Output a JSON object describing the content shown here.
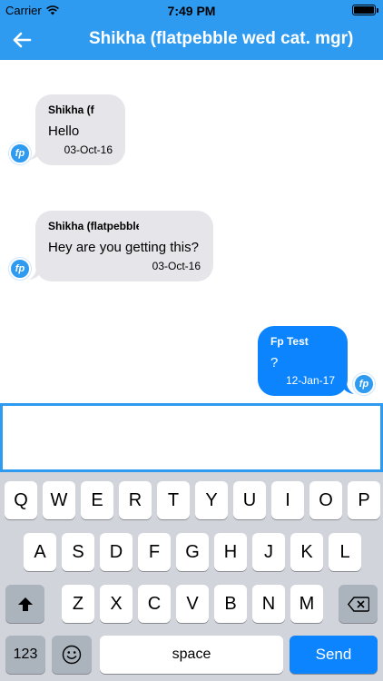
{
  "status": {
    "carrier": "Carrier",
    "time": "7:49 PM",
    "battery_fraction": 1.0
  },
  "nav": {
    "title": "Shikha (flatpebble wed cat. mgr)"
  },
  "messages": [
    {
      "sender": "Shikha (f",
      "text": "Hello",
      "date": "03-Oct-16",
      "direction": "incoming"
    },
    {
      "sender": "Shikha (flatpebble",
      "text": "Hey are you getting this?",
      "date": "03-Oct-16",
      "direction": "incoming"
    },
    {
      "sender": "Fp Test",
      "text": "?",
      "date": "12-Jan-17",
      "direction": "outgoing"
    }
  ],
  "avatar": {
    "label": "fp"
  },
  "composer": {
    "value": "",
    "placeholder": ""
  },
  "keyboard": {
    "row1": [
      "Q",
      "W",
      "E",
      "R",
      "T",
      "Y",
      "U",
      "I",
      "O",
      "P"
    ],
    "row2": [
      "A",
      "S",
      "D",
      "F",
      "G",
      "H",
      "J",
      "K",
      "L"
    ],
    "row3": [
      "Z",
      "X",
      "C",
      "V",
      "B",
      "N",
      "M"
    ],
    "numbers_label": "123",
    "space_label": "space",
    "send_label": "Send",
    "shift_icon": "shift-icon",
    "backspace_icon": "backspace-icon",
    "emoji_icon": "emoji-icon"
  },
  "colors": {
    "accent": "#2e9bf0",
    "outgoing_bubble": "#0c84fe",
    "incoming_bubble": "#e5e5ea"
  }
}
